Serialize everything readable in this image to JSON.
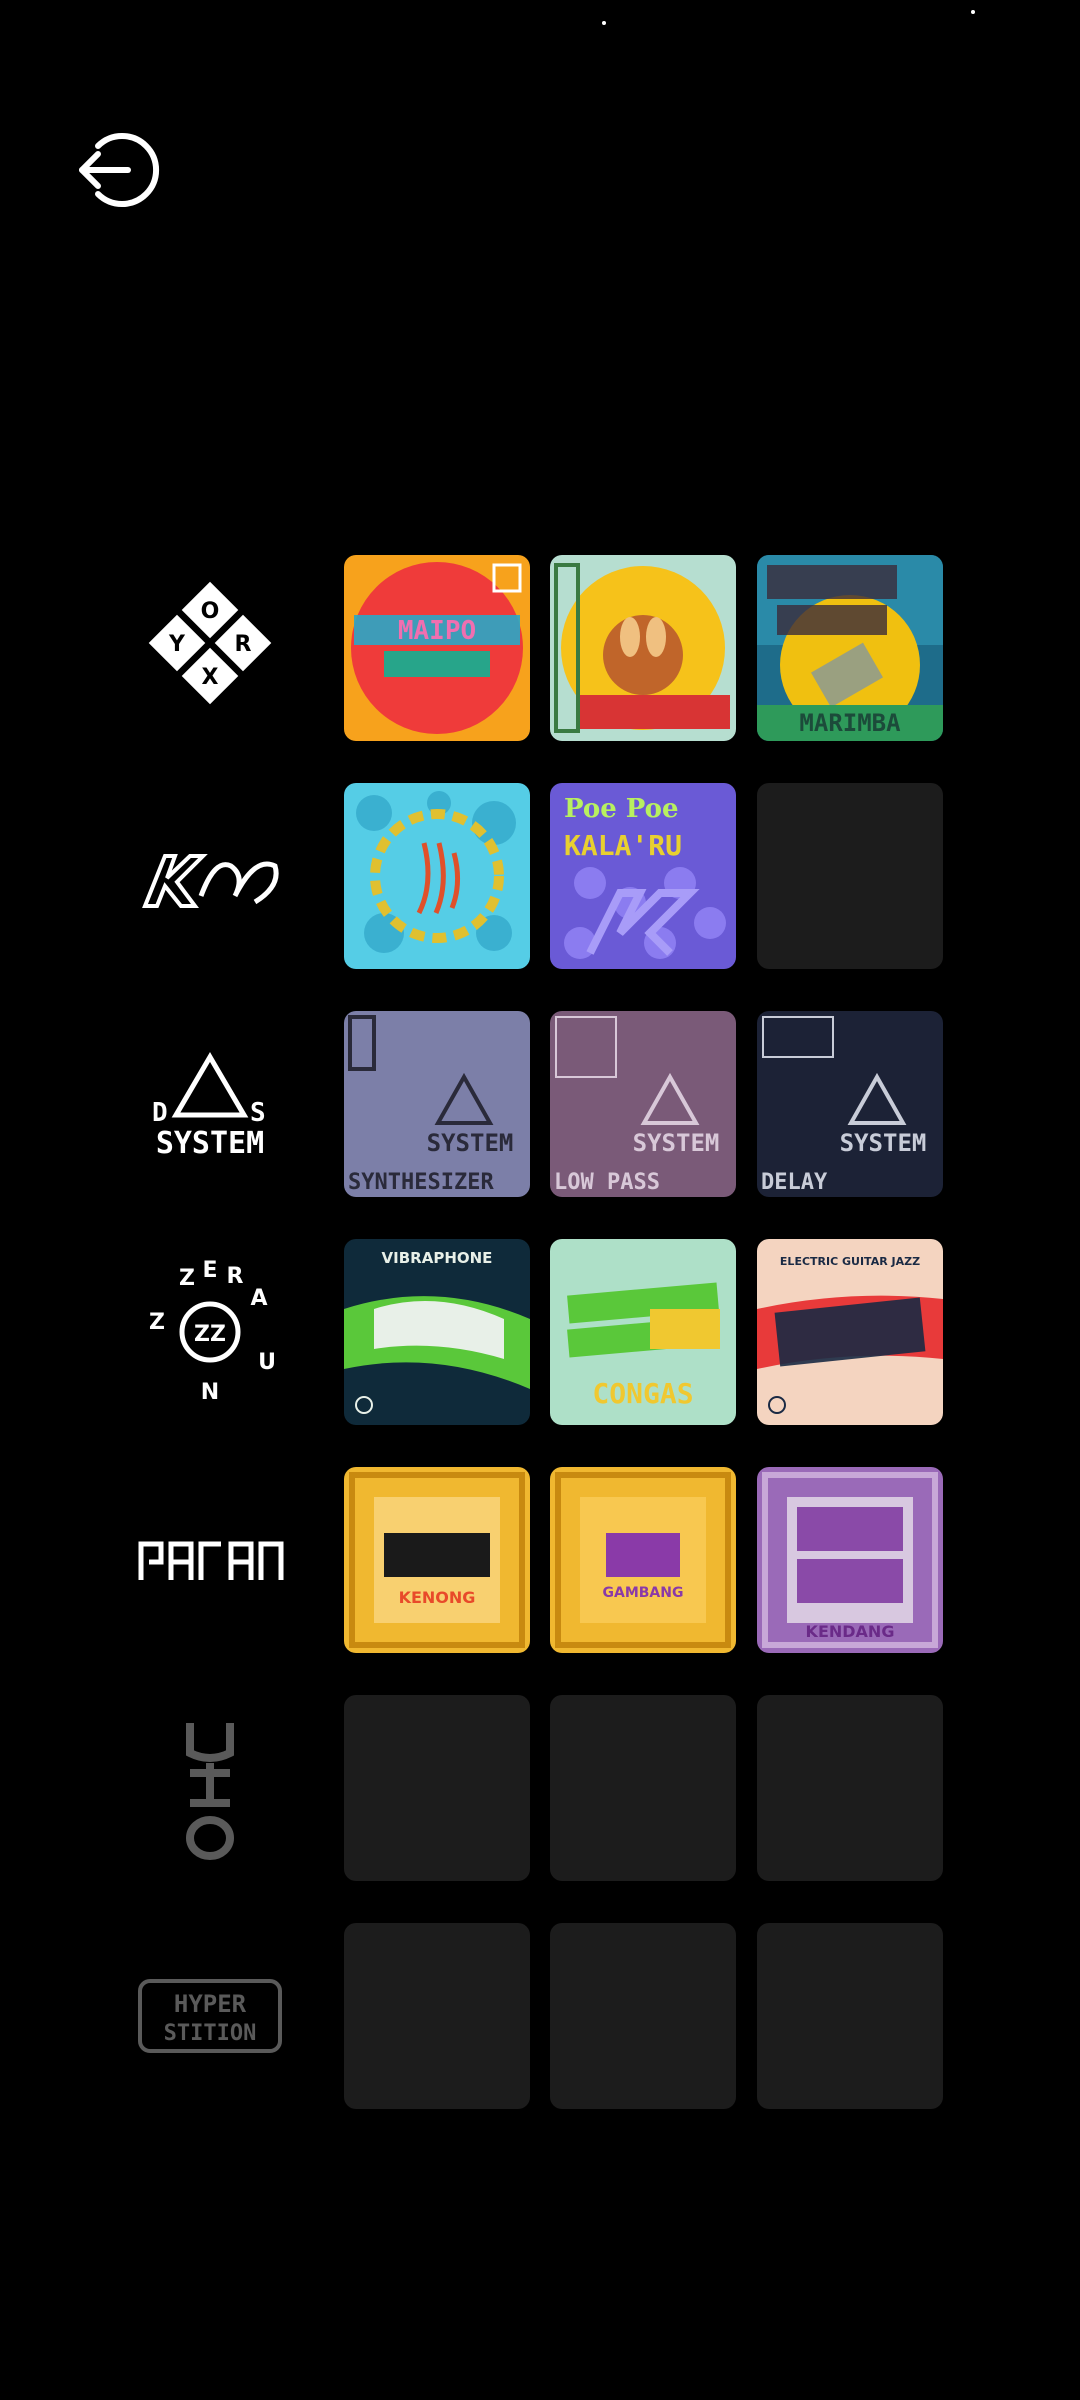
{
  "labels": {
    "oryx_letters": [
      "O",
      "R",
      "Y",
      "X"
    ],
    "ds_system": [
      "D",
      "S",
      "SYSTEM"
    ],
    "zeraun": [
      "Z",
      "E",
      "R",
      "A",
      "U",
      "N",
      "Z"
    ],
    "hyperstition": [
      "HYPER",
      "STITION"
    ],
    "kalu_title": "Ikalu",
    "mayo_title": "MAIPO",
    "tile_ds_1": "SYNTHESIZER",
    "tile_ds_2": "LOW PASS",
    "tile_ds_3": "DELAY",
    "vibraphone": "VIBRAPHONE",
    "congas": "CONGAS",
    "guitar_jazz": "ELECTRIC GUITAR JAZZ",
    "kenong": "KENONG",
    "gambang": "GAMBANG",
    "kendang": "KENDANG",
    "poe_poe": "Poe Poe",
    "kalaru": "KALA'RU",
    "marimba": "MARIMBA"
  },
  "icons": {
    "back": "logout-arrow-icon"
  }
}
